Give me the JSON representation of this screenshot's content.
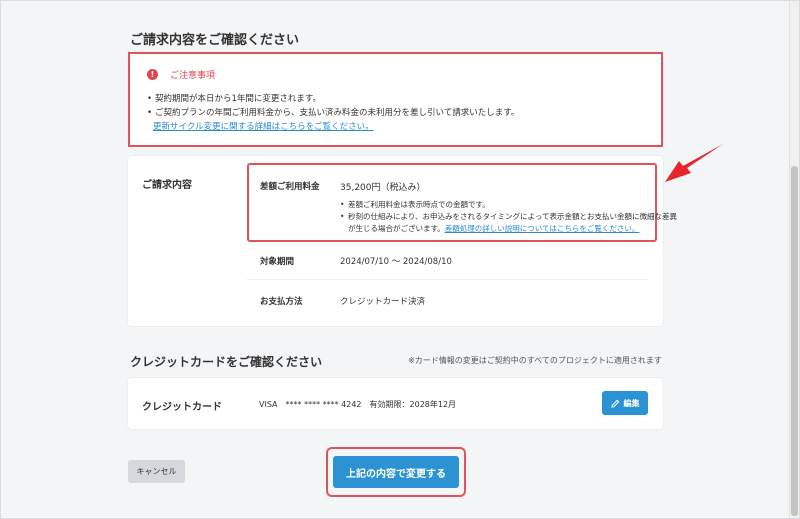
{
  "billing_section": {
    "title": "ご請求内容をご確認ください"
  },
  "notice": {
    "icon": "alert-icon",
    "title": "ご注意事項",
    "items": [
      "契約期間が本日から1年間に変更されます。",
      "ご契約プランの年間ご利用料金から、支払い済み料金の未利用分を差し引いて請求いたします。"
    ],
    "link_text": "更新サイクル変更に関する詳細はこちらをご覧ください。"
  },
  "billing_card": {
    "label": "ご請求内容",
    "diff": {
      "label": "差額ご利用料金",
      "value": "35,200円（税込み）",
      "note1": "差額ご利用料金は表示時点での金額です。",
      "note2_line1": "秒刻の仕組みにより、お申込みをされるタイミングによって表示金額とお支払い金額に微細な差異",
      "note2_line2_prefix": "が生じる場合がございます。",
      "note2_link": "差額処理の詳しい説明についてはこちらをご覧ください。"
    },
    "period": {
      "label": "対象期間",
      "value": "2024/07/10 〜 2024/08/10"
    },
    "payment": {
      "label": "お支払方法",
      "value": "クレジットカード決済"
    }
  },
  "card_section": {
    "title": "クレジットカードをご確認ください",
    "note": "※カード情報の変更はご契約中のすべてのプロジェクトに適用されます"
  },
  "credit_card": {
    "label": "クレジットカード",
    "info": "VISA　**** **** **** 4242　有効期限：2028年12月",
    "edit_label": "編集",
    "edit_icon": "pencil-icon"
  },
  "actions": {
    "cancel_label": "キャンセル",
    "submit_label": "上記の内容で変更する"
  },
  "colors": {
    "accent": "#2b93d4",
    "alert": "#e0454f",
    "highlight": "#e0535a",
    "annotation_arrow": "#e8242c"
  }
}
